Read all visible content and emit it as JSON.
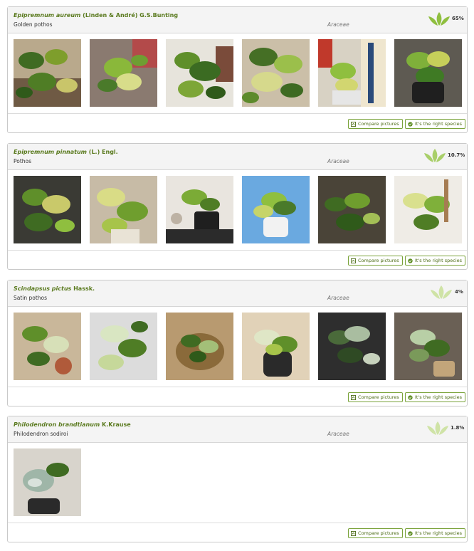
{
  "results": [
    {
      "genus_species": "Epipremnum aureum",
      "author": "(Linden & André) G.S.Bunting",
      "common_name": "Golden pothos",
      "family": "Araceae",
      "score_label": "65%",
      "confidence_level": 3,
      "photo_count": 6,
      "compare_label": "Compare pictures",
      "confirm_label": "It's the right species"
    },
    {
      "genus_species": "Epipremnum pinnatum",
      "author": "(L.) Engl.",
      "common_name": "Pothos",
      "family": "Araceae",
      "score_label": "10.7%",
      "confidence_level": 2,
      "photo_count": 6,
      "compare_label": "Compare pictures",
      "confirm_label": "It's the right species"
    },
    {
      "genus_species": "Scindapsus pictus",
      "author": "Hassk.",
      "common_name": "Satin pothos",
      "family": "Araceae",
      "score_label": "4%",
      "confidence_level": 1,
      "photo_count": 6,
      "compare_label": "Compare pictures",
      "confirm_label": "It's the right species"
    },
    {
      "genus_species": "Philodendron brandtianum",
      "author": "K.Krause",
      "common_name": "Philodendron sodiroi",
      "family": "Araceae",
      "score_label": "1.8%",
      "confidence_level": 1,
      "photo_count": 1,
      "compare_label": "Compare pictures",
      "confirm_label": "It's the right species"
    }
  ],
  "colors": {
    "accent": "#7aa33a",
    "species_text": "#5a7a1e",
    "leaf_strong": "#8fbf3f",
    "leaf_weak": "#cfe3a6"
  }
}
